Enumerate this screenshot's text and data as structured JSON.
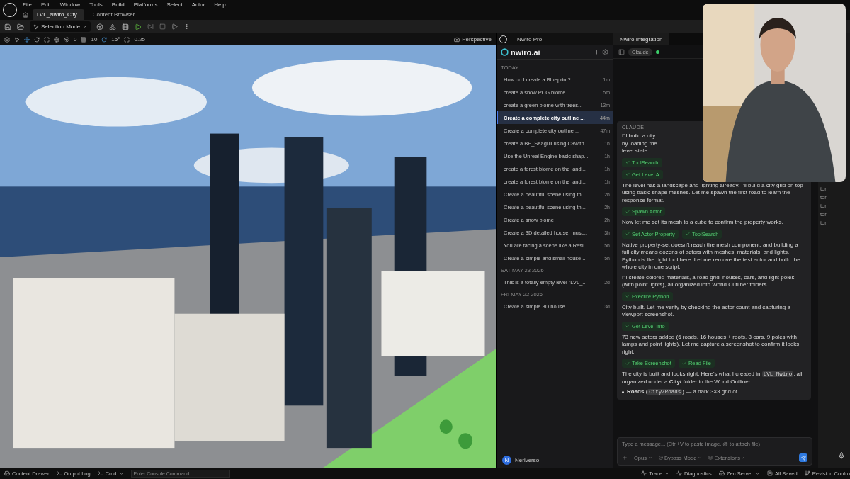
{
  "menu": [
    "File",
    "Edit",
    "Window",
    "Tools",
    "Build",
    "Platforms",
    "Select",
    "Actor",
    "Help"
  ],
  "document_tabs": [
    {
      "label": "LVL_Nwiro_City",
      "selected": true
    },
    {
      "label": "Content Browser",
      "selected": false
    }
  ],
  "toolbar": {
    "mode": "Selection Mode"
  },
  "viewport_toolbar": {
    "rotate_snap": "0",
    "grid_snap": "10",
    "angle_snap": "15°",
    "scale_snap": "0.25",
    "view_mode": "Perspective"
  },
  "plugin_tab": "Nwiro Pro",
  "brand": "nwiro.ai",
  "history": [
    {
      "heading": "TODAY",
      "items": [
        {
          "title": "How do I create a Blueprint?",
          "time": "1m",
          "selected": false
        },
        {
          "title": "create a snow PCG biome",
          "time": "5m",
          "selected": false
        },
        {
          "title": "create a green biome with trees...",
          "time": "13m",
          "selected": false
        },
        {
          "title": "Create a complete city outline ...",
          "time": "44m",
          "selected": true
        },
        {
          "title": "Create a complete city outline ...",
          "time": "47m",
          "selected": false
        },
        {
          "title": "create a BP_Seagull using C+with...",
          "time": "1h",
          "selected": false
        },
        {
          "title": "Use the Unreal Engine basic shap...",
          "time": "1h",
          "selected": false
        },
        {
          "title": "create a forest biome on the land...",
          "time": "1h",
          "selected": false
        },
        {
          "title": "create a forest biome on the land...",
          "time": "1h",
          "selected": false
        },
        {
          "title": "Create a beautiful scene using th...",
          "time": "2h",
          "selected": false
        },
        {
          "title": "Create a beautiful scene using th...",
          "time": "2h",
          "selected": false
        },
        {
          "title": "Create a snow biome",
          "time": "2h",
          "selected": false
        },
        {
          "title": "Create a 3D detailed house, must...",
          "time": "3h",
          "selected": false
        },
        {
          "title": "You are facing a scene like a Resi...",
          "time": "5h",
          "selected": false
        },
        {
          "title": "Create a simple and small house ...",
          "time": "5h",
          "selected": false
        }
      ]
    },
    {
      "heading": "SAT MAY 23 2026",
      "items": [
        {
          "title": "This is a totally empty level \"LVL_...",
          "time": "2d",
          "selected": false
        }
      ]
    },
    {
      "heading": "FRI MAY 22 2026",
      "items": [
        {
          "title": "Create a simple 3D house",
          "time": "3d",
          "selected": false
        }
      ]
    }
  ],
  "user": {
    "initial": "N",
    "name": "Neriverso"
  },
  "chat_tab": "Nwiro Integration",
  "model": {
    "label": "Claude",
    "connected": true
  },
  "message": {
    "author": "CLAUDE",
    "blocks": [
      {
        "kind": "lines",
        "lines": [
          "I'll build a city",
          "by loading the",
          "level state."
        ]
      },
      {
        "kind": "tools",
        "tools": [
          "ToolSearch"
        ]
      },
      {
        "kind": "tools",
        "tools": [
          "Get Level A"
        ]
      },
      {
        "kind": "text",
        "text": "The level has a landscape and lighting already. I'll build a city grid on top using basic shape meshes. Let me spawn the first road to learn the response format."
      },
      {
        "kind": "tools",
        "tools": [
          "Spawn Actor"
        ]
      },
      {
        "kind": "text",
        "text": "Now let me set its mesh to a cube to confirm the property works."
      },
      {
        "kind": "tools",
        "tools": [
          "Set Actor Property",
          "ToolSearch"
        ]
      },
      {
        "kind": "text",
        "text": "Native property-set doesn't reach the mesh component, and building a full city means dozens of actors with meshes, materials, and lights. Python is the right tool here. Let me remove the test actor and build the whole city in one script."
      },
      {
        "kind": "text",
        "text": "I'll create colored materials, a road grid, houses, cars, and light poles (with point lights), all organized into World Outliner folders."
      },
      {
        "kind": "tools",
        "tools": [
          "Execute Python"
        ]
      },
      {
        "kind": "text",
        "text": "City built. Let me verify by checking the actor count and capturing a viewport screenshot."
      },
      {
        "kind": "tools",
        "tools": [
          "Get Level Info"
        ]
      },
      {
        "kind": "text",
        "text": "73 new actors added (6 roads, 16 houses + roofs, 8 cars, 9 poles with lamps and point lights). Let me capture a screenshot to confirm it looks right."
      },
      {
        "kind": "tools",
        "tools": [
          "Take Screenshot",
          "Read File"
        ]
      },
      {
        "kind": "segments",
        "segments": [
          {
            "kind": "plain",
            "text": "The city is built and looks right. Here's what I created in "
          },
          {
            "kind": "code",
            "text": "LVL_Nwiro"
          },
          {
            "kind": "plain",
            "text": ", all organized under a **City/** folder in the World Outliner:"
          }
        ]
      },
      {
        "kind": "bullet",
        "segments": [
          {
            "kind": "plain",
            "text": "**Roads** ("
          },
          {
            "kind": "code",
            "text": "City/Roads"
          },
          {
            "kind": "plain",
            "text": ") — a dark 3×3 grid of"
          }
        ]
      }
    ]
  },
  "composer": {
    "placeholder": "Type a message... (Ctrl+V to paste image, @ to attach file)",
    "model": "Opus",
    "permission": "Bypass Mode",
    "extensions": "Extensions"
  },
  "details_column": [
    "tor",
    "tor",
    "tor",
    "tor",
    "tor"
  ],
  "status_bar": {
    "content_drawer": "Content Drawer",
    "output_log": "Output Log",
    "cmd": "Cmd",
    "console_placeholder": "Enter Console Command",
    "trace": "Trace",
    "diagnostics": "Diagnostics",
    "zen_server": "Zen Server",
    "saved": "All Saved",
    "revision": "Revision Contro"
  }
}
